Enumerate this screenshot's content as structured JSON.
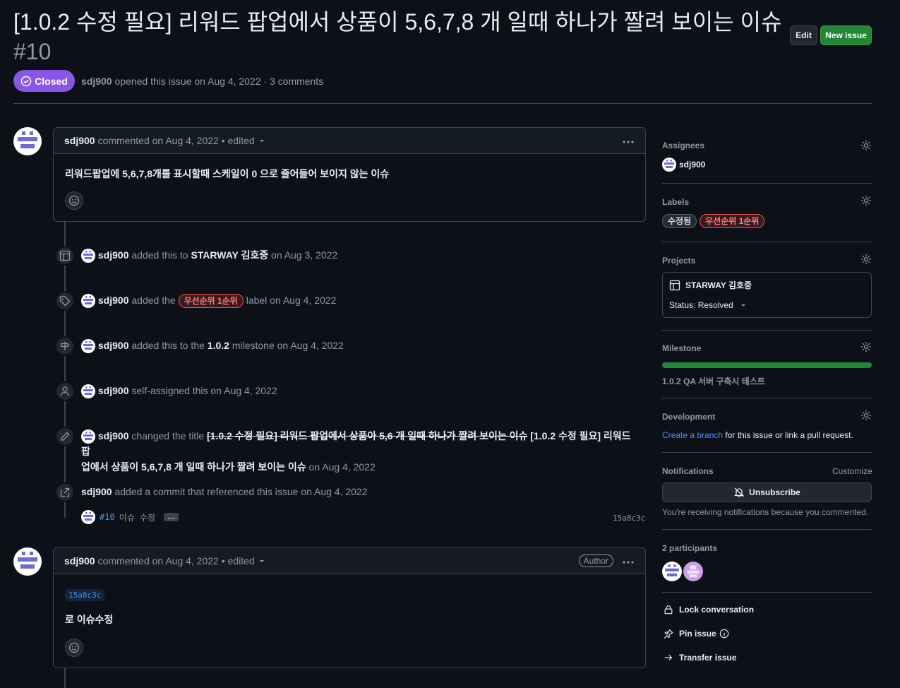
{
  "issue": {
    "title": "[1.0.2 수정 필요] 리워드 팝업에서 상품이 5,6,7,8 개 일때 하나가 짤려 보이는 이슈",
    "number": "#10",
    "state": "Closed",
    "author": "sdj900",
    "meta_text": "opened this issue on Aug 4, 2022 · 3 comments",
    "edit_label": "Edit",
    "new_issue_label": "New issue"
  },
  "comments": [
    {
      "author": "sdj900",
      "meta": "commented on Aug 4, 2022 • edited",
      "body": "리워드팝업에 5,6,7,8개를 표시할때 스케일이 0 으로 줄어들어 보이지 않는 이슈"
    },
    {
      "author": "sdj900",
      "meta": "commented on Aug 4, 2022 • edited",
      "badge": "Author",
      "sha": "15a8c3c",
      "body": "로 이슈수정"
    }
  ],
  "events": {
    "project": {
      "actor": "sdj900",
      "pre": "added this to",
      "project": "STARWAY 김호중",
      "post": "on Aug 3, 2022"
    },
    "label": {
      "actor": "sdj900",
      "pre": "added the",
      "label": "우선순위 1순위",
      "post": "label on Aug 4, 2022"
    },
    "milestone": {
      "actor": "sdj900",
      "pre": "added this to the",
      "milestone": "1.0.2",
      "post": "milestone on Aug 4, 2022"
    },
    "assign": {
      "actor": "sdj900",
      "text": "self-assigned this on Aug 4, 2022"
    },
    "rename": {
      "actor": "sdj900",
      "pre": "changed the title",
      "old_title": "[1.0.2 수정 필요] 리워드 팝업에서 상품아 5,6 개 일때 하나가 짤려 보이는 이슈",
      "new_title_line1": "[1.0.2 수정 필요] 리워드 팝",
      "new_title_line2": "업에서 상품이 5,6,7,8 개 일때 하나가 짤려 보이는 이슈",
      "post": "on Aug 4, 2022"
    },
    "commit": {
      "actor": "sdj900",
      "text": "added a commit that referenced this issue on Aug 4, 2022",
      "ref": "#10",
      "message": "이슈 수정",
      "ellipsis": "…",
      "sha": "15a8c3c"
    }
  },
  "sidebar": {
    "assignees": {
      "heading": "Assignees",
      "user": "sdj900"
    },
    "labels": {
      "heading": "Labels",
      "items": [
        "수정됨",
        "우선순위 1순위"
      ]
    },
    "projects": {
      "heading": "Projects",
      "name": "STARWAY 김호중",
      "status": "Status: Resolved"
    },
    "milestone": {
      "heading": "Milestone",
      "progress": 1.0,
      "name": "1.0.2 QA 서버 구축시 테스트"
    },
    "development": {
      "heading": "Development",
      "link": "Create a branch",
      "text": "for this issue or link a pull request."
    },
    "notifications": {
      "heading": "Notifications",
      "customize": "Customize",
      "button": "Unsubscribe",
      "note": "You're receiving notifications because you commented."
    },
    "participants": {
      "heading": "2 participants"
    },
    "actions": {
      "lock": "Lock conversation",
      "pin": "Pin issue",
      "transfer": "Transfer issue"
    }
  },
  "colors": {
    "background": "#0d1117",
    "closed": "#8957e5",
    "green": "#238636",
    "link": "#4493f8",
    "label_red": "#f85149"
  }
}
